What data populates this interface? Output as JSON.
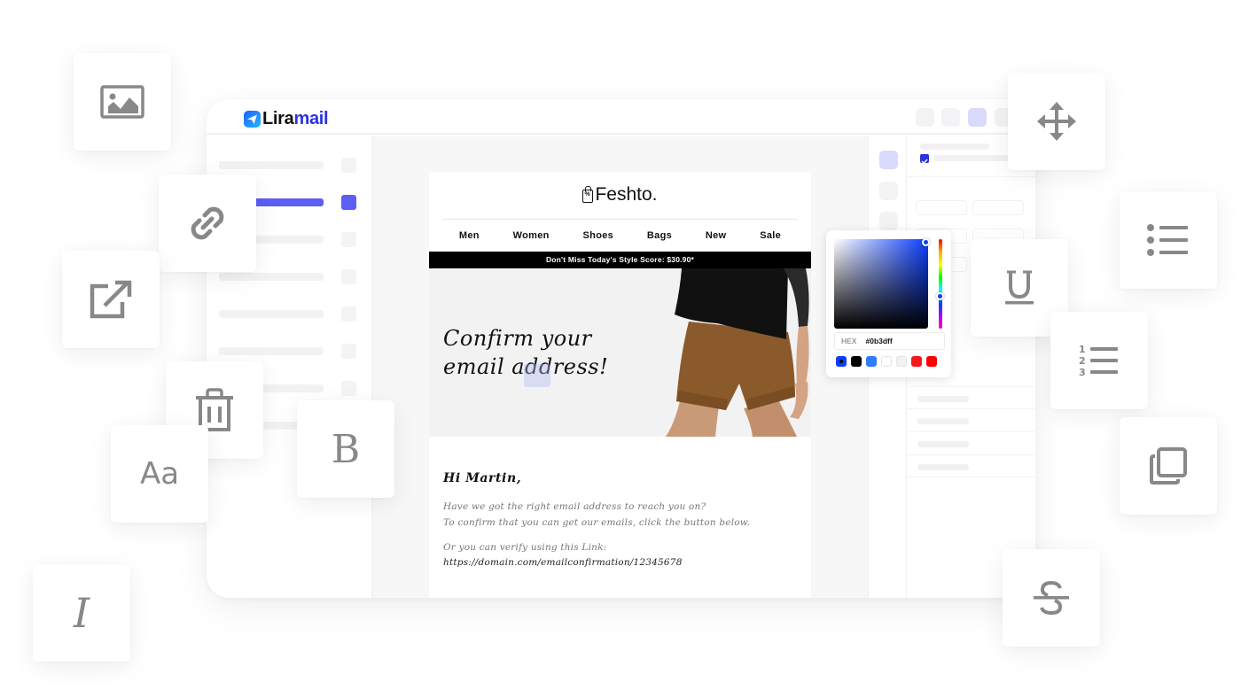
{
  "app": {
    "logo_part1": "Lira",
    "logo_part2": "mail",
    "logo_icon": "paper-plane-icon"
  },
  "email": {
    "brand": "Feshto.",
    "brand_icon": "shopping-bag-percent-icon",
    "nav": [
      "Men",
      "Women",
      "Shoes",
      "Bags",
      "New",
      "Sale"
    ],
    "promo": "Don't Miss Today's Style Score: $30.90*",
    "hero_line1": "Confirm your",
    "hero_line2": "email address!",
    "greeting": "Hi Martin,",
    "para_line1": "Have we got the right email address to reach you on?",
    "para_line2": "To confirm that you can get our emails, click the button below.",
    "verify_text": "Or you can verify using this Link:",
    "link": "https://domain.com/emailconfirmation/12345678"
  },
  "color_picker": {
    "hex_label": "HEX",
    "hex_value": "#0b3dff",
    "selected_color": "#0b3dff",
    "swatches": [
      "#0b3dff",
      "#000000",
      "#2d7bff",
      "#ffffff",
      "#f2f2f2",
      "#f5171e",
      "#ff0000"
    ]
  },
  "colors": {
    "accent": "#5d5ef2",
    "brand_blue": "#2a33e0",
    "icon_gray": "#888888"
  },
  "tiles": {
    "image": "image-icon",
    "link": "link-icon",
    "external": "external-link-icon",
    "trash": "trash-icon",
    "font": "Aa",
    "bold": "B",
    "italic": "I",
    "move": "move-icon",
    "underline": "U",
    "bulleted_list": "bulleted-list-icon",
    "numbered_list": "numbered-list-icon",
    "duplicate": "duplicate-icon",
    "strikethrough": "S"
  }
}
